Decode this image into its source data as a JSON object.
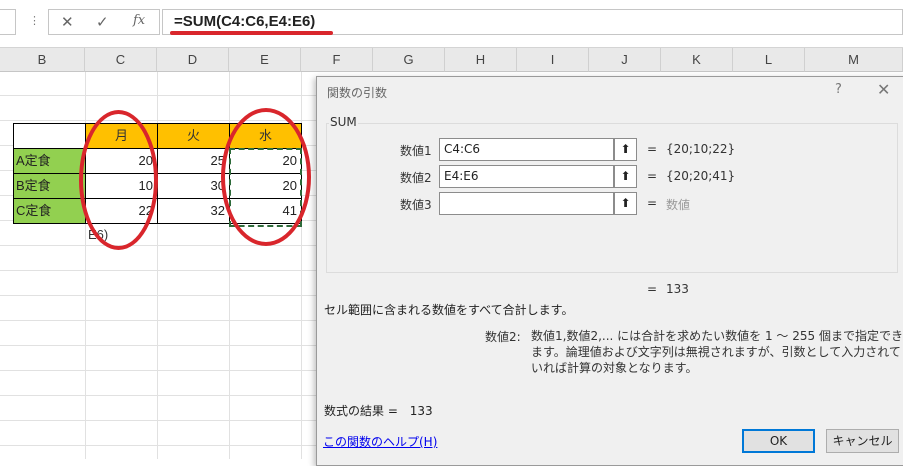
{
  "formula_bar": {
    "menu_dots": "⋮",
    "cancel_icon": "✕",
    "enter_icon": "✓",
    "fx_icon": "fx",
    "formula": "=SUM(C4:C6,E4:E6)"
  },
  "columns": [
    "B",
    "C",
    "D",
    "E",
    "F",
    "G",
    "H",
    "I",
    "J",
    "K",
    "L",
    "M"
  ],
  "table": {
    "headers": [
      "月",
      "火",
      "水"
    ],
    "rows": [
      {
        "label": "A定食",
        "values": [
          "20",
          "25",
          "20"
        ]
      },
      {
        "label": "B定食",
        "values": [
          "10",
          "30",
          "20"
        ]
      },
      {
        "label": "C定食",
        "values": [
          "22",
          "32",
          "41"
        ]
      }
    ],
    "partial_text": "E6)"
  },
  "dialog": {
    "title": "関数の引数",
    "help_icon": "?",
    "close_icon": "✕",
    "function_name": "SUM",
    "args": [
      {
        "label": "数値1",
        "value": "C4:C6",
        "eq": "=",
        "result": "{20;10;22}"
      },
      {
        "label": "数値2",
        "value": "E4:E6",
        "eq": "=",
        "result": "{20;20;41}"
      },
      {
        "label": "数値3",
        "value": "",
        "eq": "=",
        "result": "数値"
      }
    ],
    "total_eq": "=",
    "total": "133",
    "description": "セル範囲に含まれる数値をすべて合計します。",
    "arg_name": "数値2:",
    "arg_description": "数値1,数値2,... には合計を求めたい数値を 1 ～ 255 個まで指定できます。論理値および文字列は無視されますが、引数として入力されていれば計算の対象となります。",
    "result_label": "数式の結果 =",
    "result_value": "133",
    "help_link": "この関数のヘルプ(H)",
    "ok_label": "OK",
    "cancel_label": "キャンセル"
  },
  "colors": {
    "header_fill": "#ffc000",
    "label_fill": "#92d050",
    "annotation_red": "#d9262c",
    "marquee": "#2e6b3a"
  }
}
